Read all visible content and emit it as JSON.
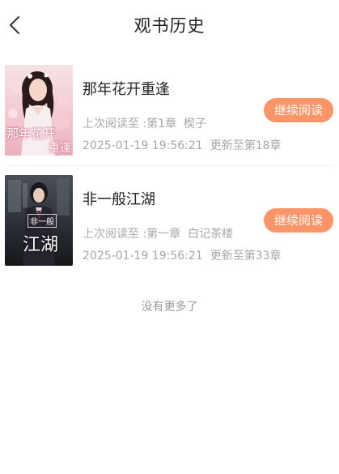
{
  "header": {
    "title": "观书历史",
    "back_icon": "chevron-left-icon"
  },
  "books": [
    {
      "title": "那年花开重逢",
      "last_read_label": "上次阅读至 :",
      "last_read_chapter": "第1章  楔子",
      "timestamp": "2025-01-19 19:56:21",
      "update_status": "更新至第18章",
      "continue_label": "继续阅读",
      "cover_text_top": "那年花开",
      "cover_text_bottom": "重逢"
    },
    {
      "title": "非一般江湖",
      "last_read_label": "上次阅读至 :",
      "last_read_chapter": "第一章  白记茶楼",
      "timestamp": "2025-01-19 19:56:21",
      "update_status": "更新至第33章",
      "continue_label": "继续阅读",
      "cover_text_top": "非一般",
      "cover_text_bottom": "江湖"
    }
  ],
  "footer": {
    "no_more_text": "没有更多了"
  },
  "colors": {
    "accent": "#fb9466",
    "title_text": "#222222",
    "secondary_text": "#a8a8a8"
  }
}
